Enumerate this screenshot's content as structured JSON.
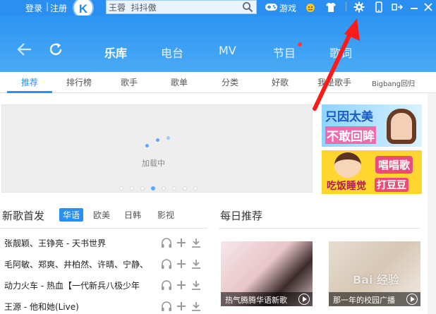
{
  "titlebar": {
    "login": "登录",
    "separator": "|",
    "register": "注册",
    "logo_letter": "K",
    "search_value": "王蓉  抖抖傲",
    "game_label": "游戏"
  },
  "mainnav": {
    "tabs": [
      {
        "label": "乐库",
        "active": true
      },
      {
        "label": "电台"
      },
      {
        "label": "MV"
      },
      {
        "label": "节目",
        "badge": true
      },
      {
        "label": "歌词"
      }
    ]
  },
  "subnav": {
    "tabs": [
      {
        "label": "推荐",
        "active": true
      },
      {
        "label": "排行榜"
      },
      {
        "label": "歌手"
      },
      {
        "label": "歌单"
      },
      {
        "label": "分类"
      },
      {
        "label": "好歌"
      },
      {
        "label": "我是歌手"
      },
      {
        "label": "Bigbang回归"
      }
    ]
  },
  "banner": {
    "loading_text": "加载中",
    "page_count": 8,
    "active_page": 4
  },
  "ads": {
    "ad1": {
      "line1": "只因太美",
      "line2": "不敢回眸"
    },
    "ad2": {
      "badge": "唱唱歌",
      "line1": "吃饭睡觉",
      "line2": "打豆豆"
    }
  },
  "newsongs": {
    "title": "新歌首发",
    "filters": [
      "华语",
      "欧美",
      "日韩",
      "影视"
    ],
    "songs": [
      "张靓颖、王铮亮 - 天书世界",
      "毛阿敏、郑爽、井柏然、许晴、宁静、",
      "动力火车 - 热血【一代新兵八极少年",
      "王源 - 他和她(Live)"
    ]
  },
  "daily": {
    "title": "每日推荐",
    "cards": [
      {
        "caption": "热气腾腾华语新歌"
      },
      {
        "caption": "那一年的校园广播"
      }
    ]
  },
  "watermark": "Bai 经验",
  "colors": {
    "brand_blue": "#2a8ff0",
    "badge_red": "#ff3b3b",
    "arrow_red": "#ff1a1a"
  }
}
